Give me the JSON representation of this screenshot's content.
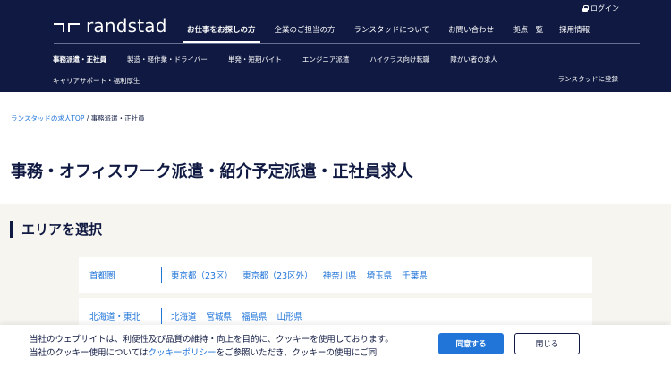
{
  "header": {
    "login": "ログイン",
    "logo": "randstad",
    "topnav": [
      "お仕事をお探しの方",
      "企業のご担当の方",
      "ランスタッドについて",
      "お問い合わせ",
      "拠点一覧",
      "採用情報"
    ],
    "subnav_row1": [
      "事務派遣・正社員",
      "製造・軽作業・ドライバー",
      "単発・短期バイト",
      "エンジニア派遣",
      "ハイクラス向け転職",
      "障がい者の求人"
    ],
    "subnav_row2": [
      "キャリアサポート・福利厚生"
    ],
    "register": "ランスタッドに登録"
  },
  "breadcrumb": {
    "home": "ランスタッドの求人TOP",
    "separator": " / ",
    "current": "事務派遣・正社員"
  },
  "page_title": "事務・オフィスワーク派遣・紹介予定派遣・正社員求人",
  "area": {
    "heading": "エリアを選択",
    "regions": [
      {
        "name": "首都圏",
        "prefectures": [
          "東京都（23区）",
          "東京都（23区外）",
          "神奈川県",
          "埼玉県",
          "千葉県"
        ]
      },
      {
        "name": "北海道・東北",
        "prefectures": [
          "北海道",
          "宮城県",
          "福島県",
          "山形県"
        ]
      }
    ]
  },
  "cookie": {
    "text_line1": "当社のウェブサイトは、利便性及び品質の維持・向上を目的に、クッキーを使用しております。",
    "text_line2_pre": "当社のクッキー使用については",
    "policy_link": "クッキーポリシー",
    "text_line2_post": "をご参照いただき、クッキーの使用にご同",
    "agree": "同意する",
    "close": "閉じる"
  },
  "colors": {
    "navy": "#0f1941",
    "blue": "#2175d9",
    "bg": "#f7f5f0"
  }
}
